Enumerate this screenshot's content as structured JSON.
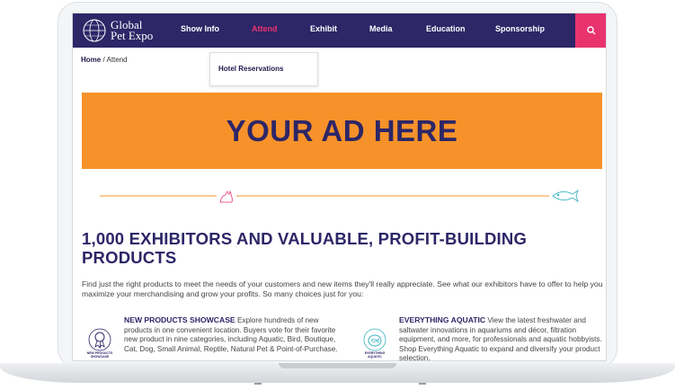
{
  "brand": {
    "line1": "Global",
    "line2": "Pet Expo"
  },
  "nav": {
    "items": [
      "Show Info",
      "Attend",
      "Exhibit",
      "Media",
      "Education",
      "Sponsorship"
    ],
    "active": "Attend",
    "search_icon": "search-icon"
  },
  "breadcrumb": {
    "home": "Home",
    "separator": "/",
    "current": "Attend"
  },
  "dropdown": {
    "item": "Hotel Reservations"
  },
  "ad": {
    "text": "YOUR AD HERE"
  },
  "headline": "1,000 EXHIBITORS AND VALUABLE, PROFIT-BUILDING PRODUCTS",
  "intro": "Find just the right products to meet the needs of your customers and new items they'll really appreciate. See what our exhibitors have to offer to help you maximize your merchandising and grow your profits. So many choices just for you:",
  "features": [
    {
      "title": "NEW PRODUCTS SHOWCASE",
      "body": "Explore hundreds of new products in one convenient location. Buyers vote for their favorite new product in nine categories, including Aquatic, Bird, Boutique, Cat, Dog, Small Animal, Reptile, Natural Pet & Point-of-Purchase.",
      "icon_label_1": "NEW PRODUCTS",
      "icon_label_2": "SHOWCASE"
    },
    {
      "title": "EVERYTHING AQUATIC",
      "body": "View the latest freshwater and saltwater innovations in aquariums and décor, filtration equipment, and more, for professionals and aquatic hobbyists. Shop Everything Aquatic to expand and diversify your product selection.",
      "icon_label_1": "EVERYTHING",
      "icon_label_2": "AQUATIC"
    }
  ],
  "colors": {
    "navy": "#2d2667",
    "pink": "#e8336f",
    "orange": "#f7922a",
    "teal": "#3bb3c3"
  }
}
